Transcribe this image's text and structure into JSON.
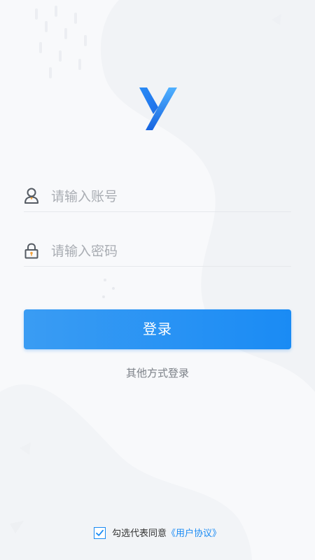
{
  "account_field": {
    "placeholder": "请输入账号",
    "value": "",
    "icon": "user-icon"
  },
  "password_field": {
    "placeholder": "请输入密码",
    "value": "",
    "icon": "lock-icon"
  },
  "login_button": {
    "label": "登录"
  },
  "other_login": {
    "label": "其他方式登录"
  },
  "agreement": {
    "checked": true,
    "text": "勾选代表同意",
    "link": "《用户协议》"
  },
  "colors": {
    "accent": "#1a8bf4",
    "logo_light": "#41a3ff",
    "logo_dark": "#1468e0",
    "icon_gray": "#555b63",
    "icon_orange": "#f2a23c"
  }
}
